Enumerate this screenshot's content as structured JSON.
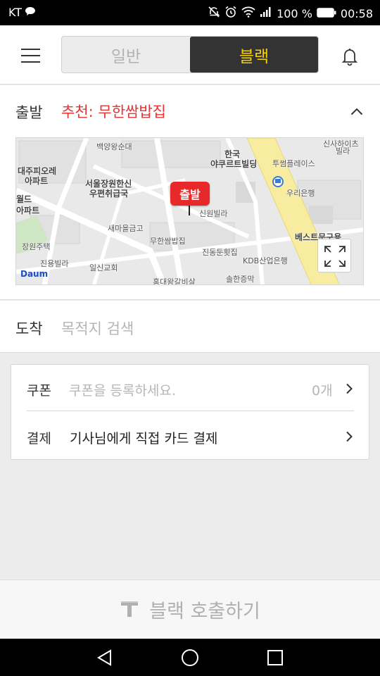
{
  "status_bar": {
    "carrier": "KT",
    "battery": "100 %",
    "time": "00:58"
  },
  "mode": {
    "normal_label": "일반",
    "black_label": "블랙",
    "selected": "블랙"
  },
  "origin": {
    "label": "출발",
    "value": "추천: 무한쌈밥집"
  },
  "map": {
    "pin_label": "출발",
    "logo": "Daum",
    "labels": [
      "백양왕순대",
      "한국",
      "야쿠르트빌딩",
      "투썸플레이스",
      "신사하이츠",
      "빌라",
      "대주피오레",
      "아파트",
      "서울장원한신",
      "우편취급국",
      "월드",
      "아파트",
      "신원빌라",
      "우리은행",
      "새마을금고",
      "무한쌈밥집",
      "베스트문구용",
      "장원주택",
      "진동둔횟집",
      "KDB산업은행",
      "진용빌라",
      "일신교회",
      "홍대왕갈비살",
      "솔한증막"
    ]
  },
  "destination": {
    "label": "도착",
    "placeholder": "목적지 검색"
  },
  "coupon": {
    "label": "쿠폰",
    "placeholder": "쿠폰을 등록하세요.",
    "count": "0개"
  },
  "payment": {
    "label": "결제",
    "value": "기사님에게 직접 카드 결제"
  },
  "call_button": {
    "label": "블랙 호출하기"
  },
  "colors": {
    "accent_red": "#e63333",
    "black_yellow": "#f3d200",
    "segment_dark": "#333333"
  }
}
